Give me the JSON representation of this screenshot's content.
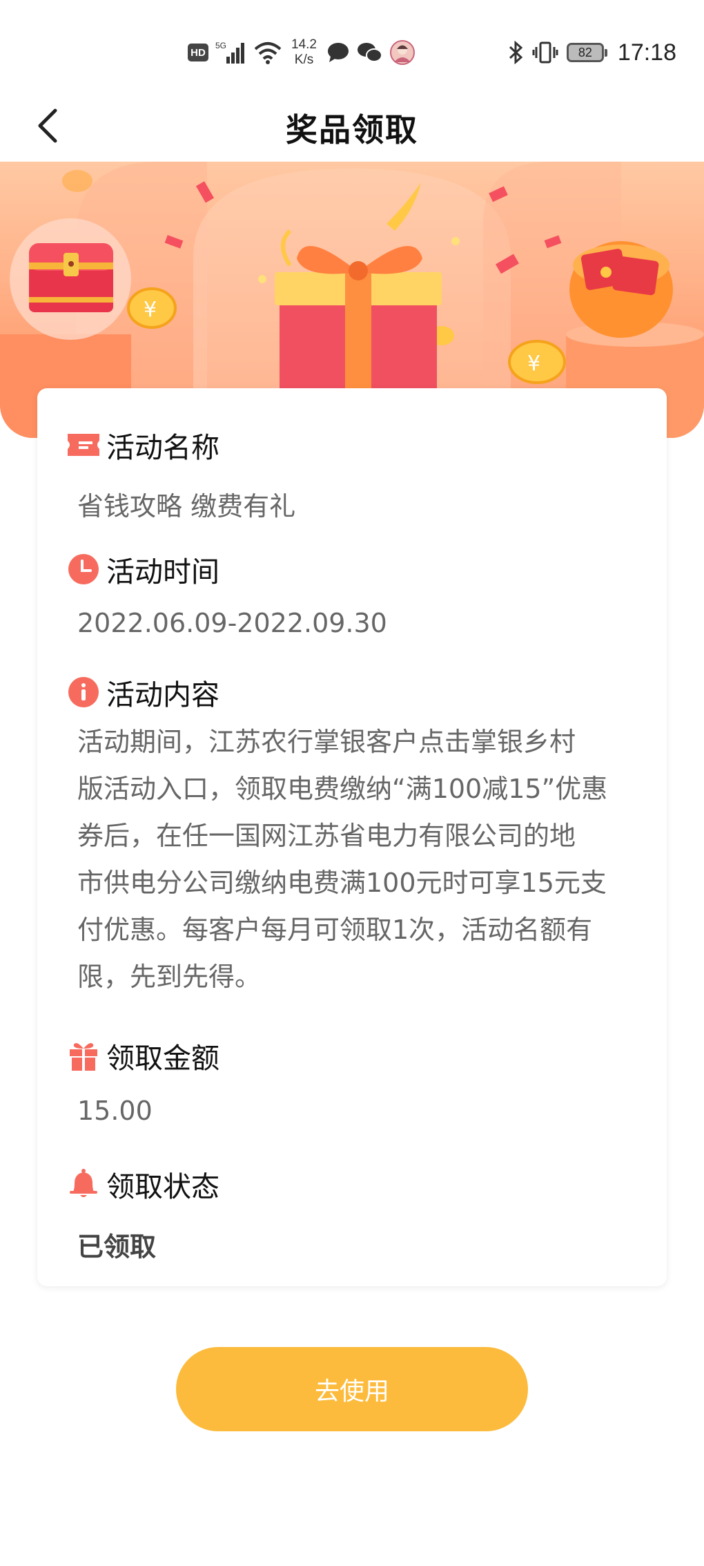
{
  "status_bar": {
    "hd": "HD",
    "signal_label": "5G",
    "net_speed_value": "14.2",
    "net_speed_unit": "K/s",
    "battery": "82",
    "time": "17:18"
  },
  "nav": {
    "title": "奖品领取"
  },
  "colors": {
    "accent": "#f76b5e",
    "button": "#fcbb3c",
    "banner": "#ff9f74"
  },
  "sections": {
    "name": {
      "title": "活动名称",
      "value": "省钱攻略 缴费有礼",
      "icon": "ticket-icon"
    },
    "time": {
      "title": "活动时间",
      "value": "2022.06.09-2022.09.30",
      "icon": "clock-icon"
    },
    "content": {
      "title": "活动内容",
      "icon": "info-icon",
      "lines": [
        "活动期间，江苏农行掌银客户点击掌银乡村",
        "版活动入口，领取电费缴纳“满100减15”优惠",
        "券后，在任一国网江苏省电力有限公司的地",
        "市供电分公司缴纳电费满100元时可享15元支",
        "付优惠。每客户每月可领取1次，活动名额有",
        "限，先到先得。"
      ]
    },
    "amount": {
      "title": "领取金额",
      "value": "15.00",
      "icon": "gift-icon"
    },
    "status": {
      "title": "领取状态",
      "value": "已领取",
      "icon": "bell-icon"
    }
  },
  "action": {
    "use_label": "去使用"
  }
}
